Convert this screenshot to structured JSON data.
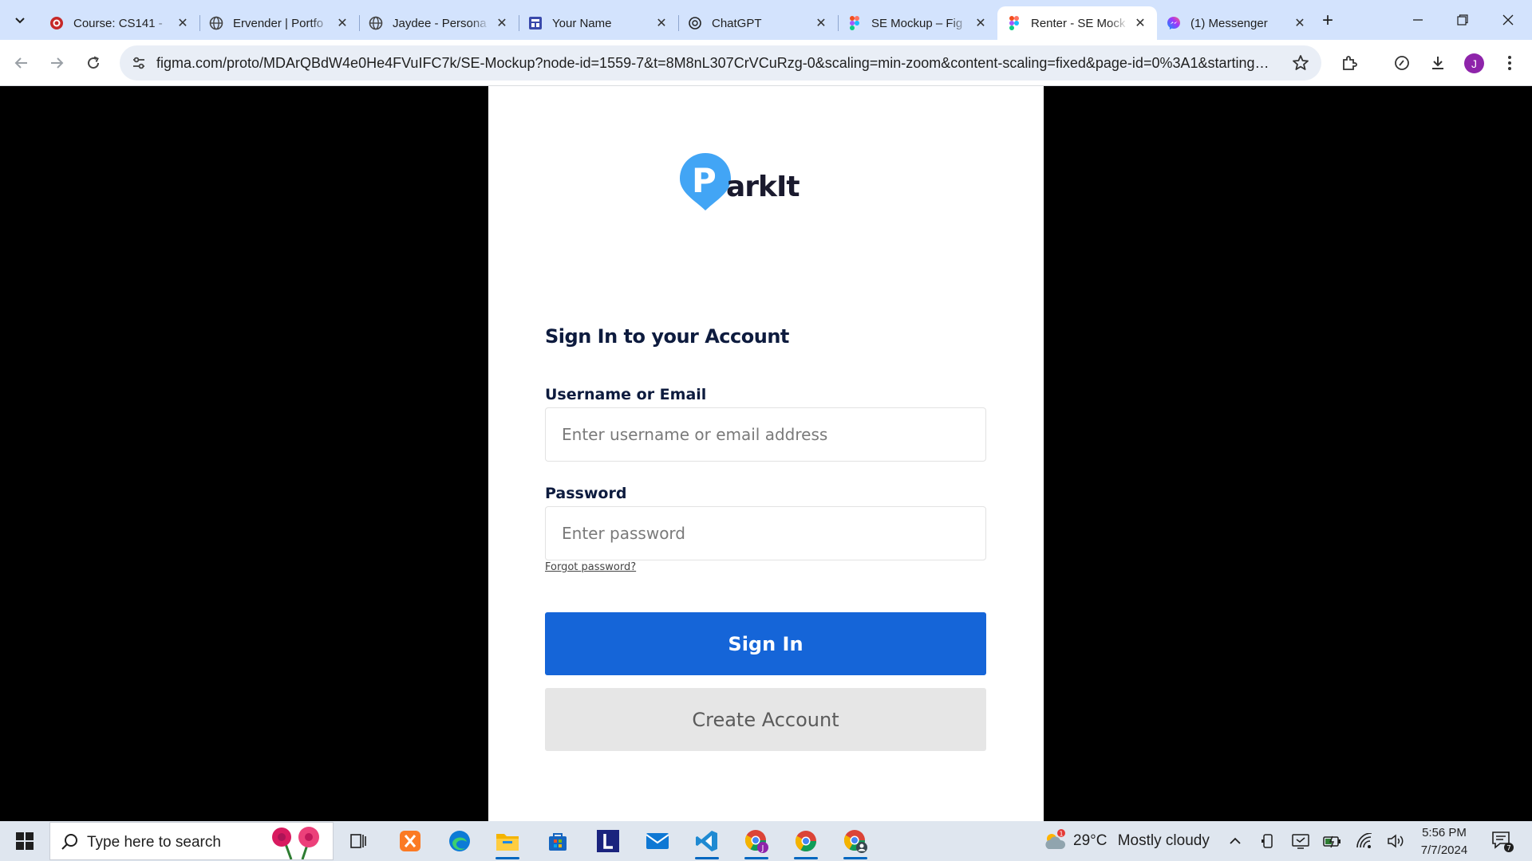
{
  "browser": {
    "tabs": [
      {
        "title": "Course: CS141 - ",
        "icon": "university-icon",
        "active": false
      },
      {
        "title": "Ervender | Portfo",
        "icon": "globe-icon",
        "active": false
      },
      {
        "title": "Jaydee - Persona",
        "icon": "globe-icon",
        "active": false
      },
      {
        "title": "Your Name",
        "icon": "form-icon",
        "active": false
      },
      {
        "title": "ChatGPT",
        "icon": "chatgpt-icon",
        "active": false
      },
      {
        "title": "SE Mockup – Fig",
        "icon": "figma-icon",
        "active": false
      },
      {
        "title": "Renter - SE Mock",
        "icon": "figma-icon",
        "active": true
      },
      {
        "title": "(1) Messenger",
        "icon": "messenger-icon",
        "active": false
      }
    ],
    "url": "figma.com/proto/MDArQBdW4e0He4FVuIFC7k/SE-Mockup?node-id=1559-7&t=8M8nL307CrVCuRzg-0&scaling=min-zoom&content-scaling=fixed&page-id=0%3A1&starting-poin...",
    "profile_initial": "J",
    "colors": {
      "tabstrip": "#d3e3fd",
      "profile": "#8e24aa"
    }
  },
  "app": {
    "logo_letter": "P",
    "logo_text": "arkIt",
    "heading": "Sign In to your Account",
    "username_label": "Username or Email",
    "username_placeholder": "Enter username or email address",
    "password_label": "Password",
    "password_placeholder": "Enter password",
    "forgot_link": "Forgot password?",
    "sign_in_button": "Sign In",
    "create_account_button": "Create Account",
    "colors": {
      "primary": "#1565d8",
      "logo_pin": "#42a5f5",
      "secondary_bg": "#e6e6e6",
      "heading": "#0d1b3e"
    }
  },
  "taskbar": {
    "search_placeholder": "Type here to search",
    "apps": [
      "task-view-icon",
      "xampp-icon",
      "edge-icon",
      "file-explorer-icon",
      "store-icon",
      "l-app-icon",
      "mail-icon",
      "vscode-icon",
      "chrome-profile-icon",
      "chrome-icon",
      "chrome-profile-2-icon"
    ],
    "weather_temp": "29°C",
    "weather_desc": "Mostly cloudy",
    "weather_alert": "1",
    "time": "5:56 PM",
    "date": "7/7/2024",
    "notification_count": "7"
  }
}
